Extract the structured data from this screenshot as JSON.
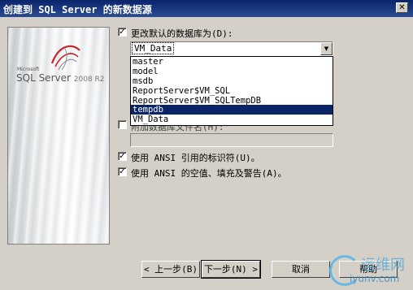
{
  "window": {
    "title": "创建到 SQL Server 的新数据源",
    "close_glyph": "✕"
  },
  "banner": {
    "logo_small": "Microsoft",
    "logo_main": "SQL Server",
    "logo_version": "2008 R2"
  },
  "default_db": {
    "checked": true,
    "label": "更改默认的数据库为(D):",
    "selected_value": "VM_Data",
    "options": [
      "master",
      "model",
      "msdb",
      "ReportServer$VM_SQL",
      "ReportServer$VM_SQLTempDB",
      "tempdb",
      "VM_Data"
    ],
    "highlighted": "tempdb"
  },
  "attach": {
    "checked": false,
    "label_partial": "附加数据库文件名(H):",
    "filename_value": ""
  },
  "ansi_quoted": {
    "checked": true,
    "label": "使用 ANSI 引用的标识符(U)。"
  },
  "ansi_nulls": {
    "checked": true,
    "label": "使用 ANSI 的空值、填充及警告(A)。"
  },
  "buttons": {
    "back": "< 上一步(B)",
    "next": "下一步(N) >",
    "cancel": "取消",
    "help": "帮助"
  },
  "check_glyph": "✓",
  "arrow_glyph": "▼",
  "watermark": {
    "text_cn": "运维网",
    "text_url": "iyunv.com"
  }
}
